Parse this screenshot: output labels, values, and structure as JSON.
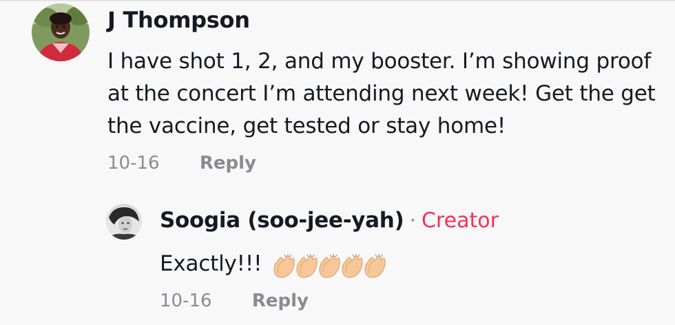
{
  "comment": {
    "username": "J Thompson",
    "text": "I have shot 1, 2, and my booster. I’m showing proof at the concert I’m attending next week! Get the get the vaccine, get tested or stay home!",
    "date": "10-16",
    "reply_label": "Reply"
  },
  "reply": {
    "username": "Soogia (soo-jee-yah)",
    "separator": "·",
    "badge": "Creator",
    "text": "Exactly!!!",
    "emoji": "clapping-hands",
    "emoji_count": 5,
    "date": "10-16",
    "reply_label": "Reply"
  },
  "colors": {
    "creator_badge": "#fe2c55",
    "meta_text": "#8a8b91",
    "primary_text": "#161823",
    "background": "#f8f8f8"
  }
}
